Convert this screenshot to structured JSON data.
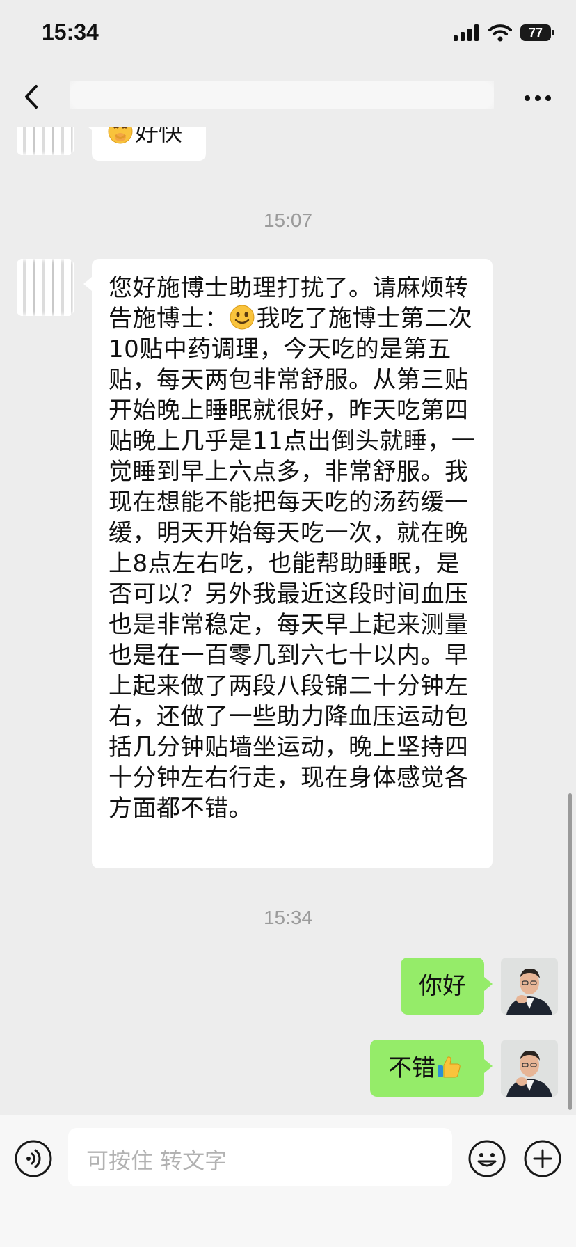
{
  "status_bar": {
    "time": "15:34",
    "battery": "77"
  },
  "nav": {
    "title": ""
  },
  "messages": [
    {
      "id": "m1",
      "from": "contact",
      "emoji": "smirk-face",
      "text": "好快"
    },
    {
      "id": "ts1",
      "type": "timestamp",
      "text": "15:07"
    },
    {
      "id": "m2",
      "from": "contact",
      "text_part1": "您好施博士助理打扰了。请麻烦转告施博士：",
      "emoji": "smiley-face",
      "text_part2": "我吃了施博士第二次10贴中药调理，今天吃的是第五贴，每天两包非常舒服。从第三贴开始晚上睡眠就很好，昨天吃第四贴晚上几乎是11点出倒头就睡，一觉睡到早上六点多，非常舒服。我现在想能不能把每天吃的汤药缓一缓，明天开始每天吃一次，就在晚上8点左右吃，也能帮助睡眠，是否可以？另外我最近这段时间血压也是非常稳定，每天早上起来测量也是在一百零几到六七十以内。早上起来做了两段八段锦二十分钟左右，还做了一些助力降血压运动包括几分钟贴墙坐运动，晚上坚持四十分钟左右行走，现在身体感觉各方面都不错。"
    },
    {
      "id": "ts2",
      "type": "timestamp",
      "text": "15:34"
    },
    {
      "id": "m3",
      "from": "me",
      "text": "你好"
    },
    {
      "id": "m4",
      "from": "me",
      "text": "不错",
      "emoji": "thumbs-up"
    }
  ],
  "input": {
    "placeholder": "可按住 转文字"
  },
  "colors": {
    "background": "#ededed",
    "incoming_bubble": "#ffffff",
    "outgoing_bubble": "#95ec69",
    "timestamp": "#9b9b9b"
  }
}
